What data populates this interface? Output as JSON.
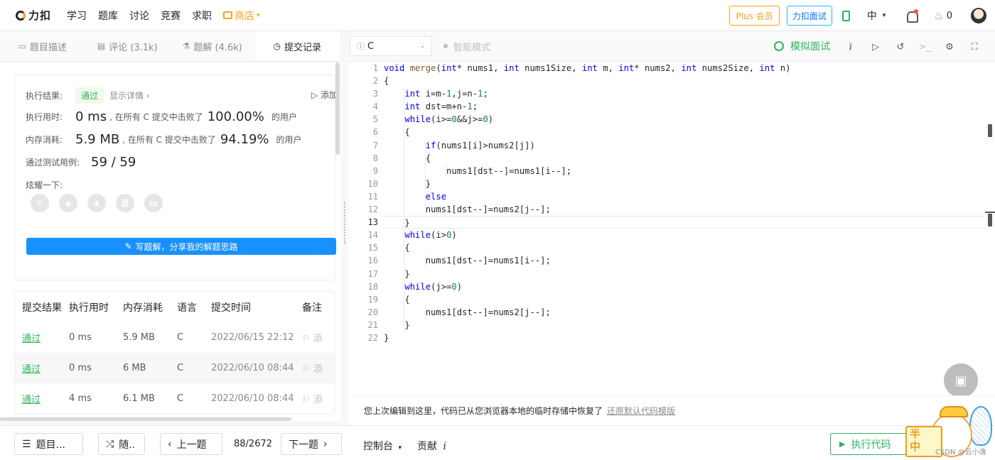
{
  "nav": {
    "logo": "力扣",
    "links": [
      "学习",
      "题库",
      "讨论",
      "竞赛",
      "求职"
    ],
    "shop": "商店",
    "plus": "Plus 会员",
    "interview": "力扣面试",
    "lang": "中",
    "fire_count": "0"
  },
  "left": {
    "tabs": [
      {
        "icon": "▭",
        "label": "题目描述"
      },
      {
        "icon": "▤",
        "label": "评论 (3.1k)"
      },
      {
        "icon": "⚗",
        "label": "题解 (4.6k)"
      },
      {
        "icon": "◷",
        "label": "提交记录"
      }
    ],
    "result": {
      "label": "执行结果:",
      "status": "通过",
      "detail_link": "显示详情",
      "add_note": "添加",
      "time_label": "执行用时:",
      "time_value": "0 ms",
      "time_text": ", 在所有 C 提交中击败了",
      "time_pct": "100.00%",
      "time_tail": "的用户",
      "mem_label": "内存消耗:",
      "mem_value": "5.9 MB",
      "mem_text": ", 在所有 C 提交中击败了",
      "mem_pct": "94.19%",
      "mem_tail": "的用户",
      "cases_label": "通过测试用例:",
      "cases_value": "59 / 59",
      "share_label": "炫耀一下:",
      "share_icons": [
        "wechat-icon",
        "weibo-icon",
        "qq-icon",
        "douban-icon",
        "linkedin-icon"
      ],
      "write_btn": "写题解，分享我的解题思路"
    },
    "table": {
      "headers": [
        "提交结果",
        "执行用时",
        "内存消耗",
        "语言",
        "提交时间",
        "备注"
      ],
      "rows": [
        {
          "result": "通过",
          "time": "0 ms",
          "mem": "5.9 MB",
          "lang": "C",
          "date": "2022/06/15 22:12",
          "note": "添"
        },
        {
          "result": "通过",
          "time": "0 ms",
          "mem": "6 MB",
          "lang": "C",
          "date": "2022/06/10 08:44",
          "note": "添"
        },
        {
          "result": "通过",
          "time": "4 ms",
          "mem": "6.1 MB",
          "lang": "C",
          "date": "2022/06/10 08:44",
          "note": "添"
        }
      ]
    }
  },
  "editor": {
    "language": "C",
    "smart_mode": "智能模式",
    "mock_interview": "模拟面试",
    "current_line": 13,
    "lines": [
      "void merge(int* nums1, int nums1Size, int m, int* nums2, int nums2Size, int n)",
      "{",
      "    int i=m-1,j=n-1;",
      "    int dst=m+n-1;",
      "    while(i>=0&&j>=0)",
      "    {",
      "        if(nums1[i]>nums2[j])",
      "        {",
      "            nums1[dst--]=nums1[i--];",
      "        }",
      "        else",
      "        nums1[dst--]=nums2[j--];",
      "    }",
      "    while(i>0)",
      "    {",
      "        nums1[dst--]=nums1[i--];",
      "    }",
      "    while(j>=0)",
      "    {",
      "        nums1[dst--]=nums2[j--];",
      "    }",
      "}"
    ],
    "notice": "您上次编辑到这里，代码已从您浏览器本地的临时存储中恢复了",
    "restore_link": "还原默认代码模版"
  },
  "bottom": {
    "problems": "题目...",
    "random": "随..",
    "prev": "上一题",
    "page": "88/2672",
    "next": "下一题",
    "console": "控制台",
    "contribute": "贡献",
    "run": "执行代码"
  },
  "sticker": {
    "sign": "半\n中"
  },
  "watermark": "CSDN @云小逸"
}
